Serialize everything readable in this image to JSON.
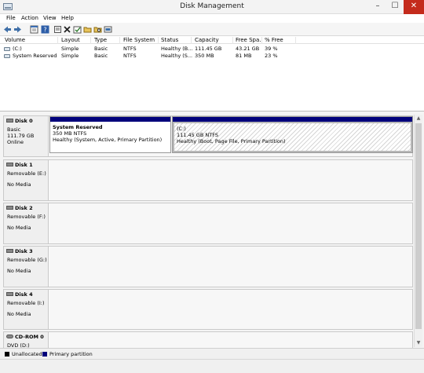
{
  "window": {
    "title": "Disk Management",
    "minimize": "–",
    "maximize": "☐",
    "close": "✕"
  },
  "menu": [
    "File",
    "Action",
    "View",
    "Help"
  ],
  "toolbar": [
    "back-icon",
    "forward-icon",
    "properties-icon",
    "help-icon",
    "open-icon",
    "delete-icon",
    "check-icon",
    "open-folder-icon",
    "explore-icon",
    "shrink-icon"
  ],
  "volume_list": {
    "columns": [
      "Volume",
      "Layout",
      "Type",
      "File System",
      "Status",
      "Capacity",
      "Free Spa...",
      "% Free"
    ],
    "rows": [
      [
        "(C:)",
        "Simple",
        "Basic",
        "NTFS",
        "Healthy (B...",
        "111.45 GB",
        "43.21 GB",
        "39 %"
      ],
      [
        "System Reserved",
        "Simple",
        "Basic",
        "NTFS",
        "Healthy (S...",
        "350 MB",
        "81 MB",
        "23 %"
      ]
    ]
  },
  "disks": [
    {
      "name": "Disk 0",
      "lines": [
        "Basic",
        "111.79 GB",
        "Online"
      ],
      "partitions": [
        {
          "title": "System Reserved",
          "lines": [
            "350 MB NTFS",
            "Healthy (System, Active, Primary Partition)"
          ]
        },
        {
          "title": "(C:)",
          "lines": [
            "111.45 GB NTFS",
            "Healthy (Boot, Page File, Primary Partition)"
          ]
        }
      ]
    },
    {
      "name": "Disk 1",
      "lines": [
        "Removable (E:)",
        "No Media"
      ]
    },
    {
      "name": "Disk 2",
      "lines": [
        "Removable (F:)",
        "No Media"
      ]
    },
    {
      "name": "Disk 3",
      "lines": [
        "Removable (G:)",
        "No Media"
      ]
    },
    {
      "name": "Disk 4",
      "lines": [
        "Removable (I:)",
        "No Media"
      ]
    },
    {
      "name": "CD-ROM 0",
      "lines": [
        "DVD (D:)"
      ]
    }
  ],
  "legend": [
    {
      "label": "Unallocated",
      "color": "#000000"
    },
    {
      "label": "Primary partition",
      "color": "#00007b"
    }
  ],
  "colors": {
    "partition_header": "#00007b",
    "close_button": "#c42b1c"
  }
}
